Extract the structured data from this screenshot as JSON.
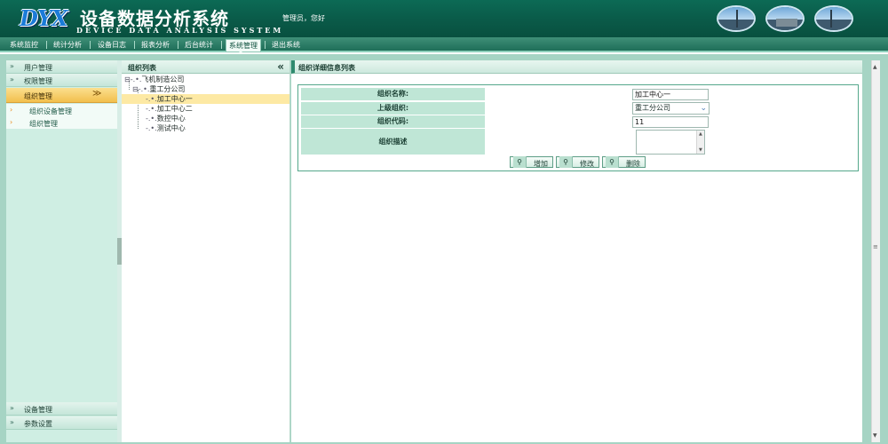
{
  "header": {
    "logo": "DYX",
    "title_cn": "设备数据分析系统",
    "title_en": "DEVICE DATA ANALYSIS SYSTEM",
    "greeting": "管理员，您好"
  },
  "nav": {
    "items": [
      {
        "label": "系统监控"
      },
      {
        "label": "统计分析"
      },
      {
        "label": "设备日志"
      },
      {
        "label": "报表分析"
      },
      {
        "label": "后台统计"
      },
      {
        "label": "系统管理"
      },
      {
        "label": "退出系统"
      }
    ],
    "active_index": 5
  },
  "sidebar": {
    "items": [
      {
        "label": "用户管理",
        "icon": "double-chevron-right-icon"
      },
      {
        "label": "权限管理",
        "icon": "double-chevron-right-icon"
      },
      {
        "label": "组织管理",
        "icon": "double-chevron-down-icon"
      }
    ],
    "subitems": [
      {
        "label": "组织设备管理"
      },
      {
        "label": "组织管理"
      }
    ],
    "bottom_items": [
      {
        "label": "设备管理"
      },
      {
        "label": "参数设置"
      }
    ],
    "expand_glyph": "»",
    "down_glyph": "≫"
  },
  "tree": {
    "title": "组织列表",
    "collapse_glyph": "«",
    "nodes": [
      {
        "label": "飞机制造公司"
      },
      {
        "label": "重工分公司"
      },
      {
        "label": "加工中心一"
      },
      {
        "label": "加工中心二"
      },
      {
        "label": "数控中心"
      },
      {
        "label": "测试中心"
      }
    ]
  },
  "detail": {
    "title": "组织详细信息列表",
    "fields": {
      "name_label": "组织名称:",
      "name_value": "加工中心一",
      "parent_label": "上级组织:",
      "parent_value": "重工分公司",
      "code_label": "组织代码:",
      "code_value": "11",
      "desc_label": "组织描述",
      "desc_value": ""
    },
    "buttons": [
      {
        "label": "增加",
        "icon": "search-icon"
      },
      {
        "label": "修改",
        "icon": "search-icon"
      },
      {
        "label": "删除",
        "icon": "search-icon"
      }
    ]
  },
  "colors": {
    "header": "#0a5a48",
    "nav": "#1e6e58",
    "active_menu": "#f2bf4d",
    "selected_tree": "#fde9a4",
    "label_cell": "#bfe6d6"
  }
}
